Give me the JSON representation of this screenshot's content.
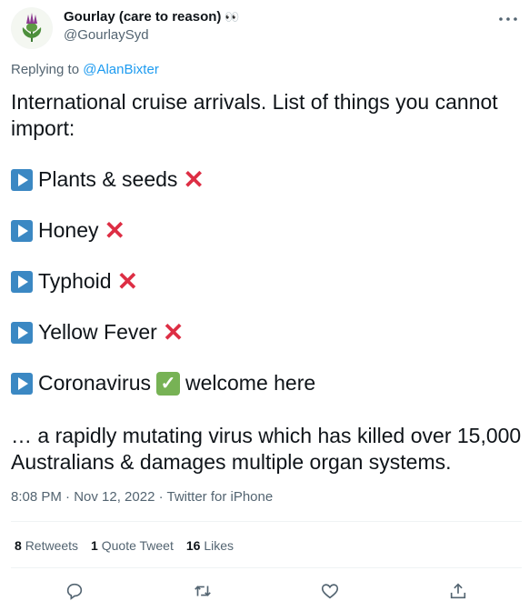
{
  "author": {
    "name": "Gourlay (care to reason)",
    "emoji": "👀",
    "handle": "@GourlaySyd"
  },
  "reply": {
    "prefix": "Replying to ",
    "target": "@AlanBixter"
  },
  "tweet": {
    "intro": "International cruise arrivals. List of things you cannot import:",
    "items": [
      {
        "label": "Plants & seeds"
      },
      {
        "label": "Honey"
      },
      {
        "label": "Typhoid"
      },
      {
        "label": "Yellow Fever"
      },
      {
        "label": "Coronavirus",
        "note": "welcome here"
      }
    ],
    "tail": "… a rapidly mutating virus which has killed over 15,000 Australians & damages multiple organ systems."
  },
  "meta": {
    "text": "8:08 PM · Nov 12, 2022 · Twitter for iPhone"
  },
  "stats": {
    "retweets_count": "8",
    "retweets_label": "Retweets",
    "quotes_count": "1",
    "quotes_label": "Quote Tweet",
    "likes_count": "16",
    "likes_label": "Likes"
  },
  "icons": {
    "more": "more-icon",
    "reply": "reply-icon",
    "retweet": "retweet-icon",
    "like": "like-icon",
    "share": "share-icon"
  },
  "colors": {
    "link": "#1d9bf0",
    "secondary": "#536471",
    "cross": "#dd2e44",
    "check": "#77b255",
    "play": "#3b88c3"
  }
}
